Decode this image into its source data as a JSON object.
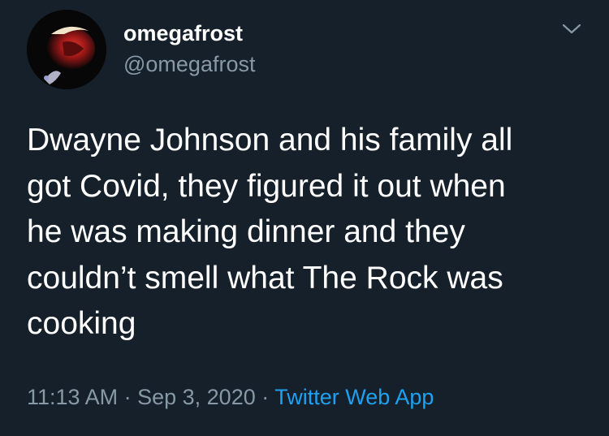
{
  "user": {
    "display_name": "omegafrost",
    "handle": "@omegafrost"
  },
  "tweet": {
    "text": "Dwayne Johnson and his family all\ngot Covid, they figured it out when\nhe was making dinner and they\ncouldn’t smell what The Rock was\ncooking",
    "time": "11:13 AM",
    "separator": "·",
    "date": "Sep 3, 2020",
    "source": "Twitter Web App"
  },
  "icons": {
    "menu": "chevron-down-icon"
  },
  "colors": {
    "background": "#15202b",
    "primary_text": "#ffffff",
    "secondary_text": "#8899a6",
    "accent": "#1da1f2"
  }
}
